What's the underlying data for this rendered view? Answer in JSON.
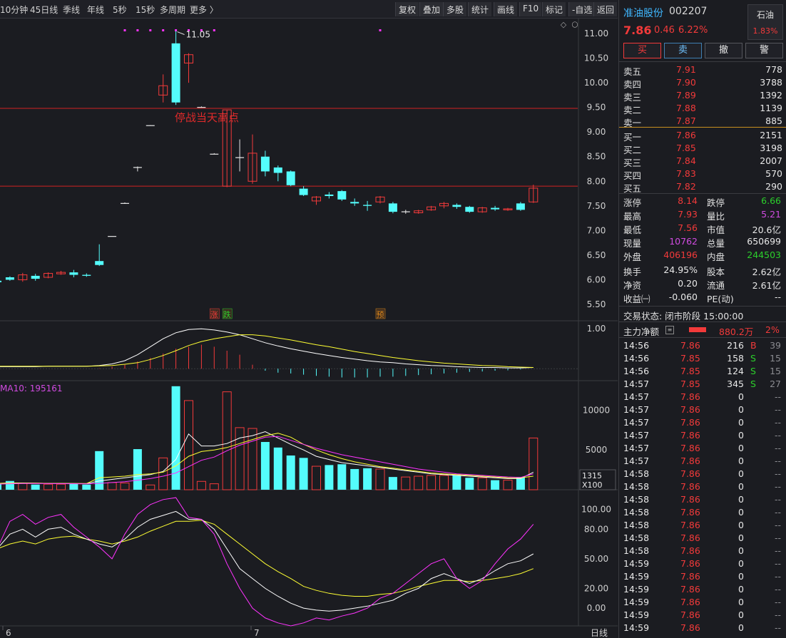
{
  "toolbar": {
    "periods": [
      "10分钟",
      "45日线",
      "季线",
      "年线",
      "5秒",
      "15秒",
      "多周期",
      "更多 〉"
    ],
    "tools": [
      "复权",
      "叠加",
      "多股",
      "统计",
      "画线",
      "F10",
      "标记",
      "-自选",
      "返回"
    ]
  },
  "stock": {
    "name": "准油股份",
    "code": "002207",
    "sector": "石油",
    "sector_pct": "1.83%",
    "price": "7.86",
    "change": "0.46",
    "change_pct": "6.22%"
  },
  "trade_buttons": [
    "买",
    "卖",
    "撤",
    "警"
  ],
  "order_book": {
    "asks": [
      {
        "label": "卖五",
        "price": "7.91",
        "vol": "778"
      },
      {
        "label": "卖四",
        "price": "7.90",
        "vol": "3788"
      },
      {
        "label": "卖三",
        "price": "7.89",
        "vol": "1392"
      },
      {
        "label": "卖二",
        "price": "7.88",
        "vol": "1139"
      },
      {
        "label": "卖一",
        "price": "7.87",
        "vol": "885"
      }
    ],
    "bids": [
      {
        "label": "买一",
        "price": "7.86",
        "vol": "2151"
      },
      {
        "label": "买二",
        "price": "7.85",
        "vol": "3198"
      },
      {
        "label": "买三",
        "price": "7.84",
        "vol": "2007"
      },
      {
        "label": "买四",
        "price": "7.83",
        "vol": "570"
      },
      {
        "label": "买五",
        "price": "7.82",
        "vol": "290"
      }
    ]
  },
  "stats": [
    {
      "l1": "涨停",
      "v1": "8.14",
      "c1": "#f23a3a",
      "l2": "跌停",
      "v2": "6.66",
      "c2": "#2bd02b"
    },
    {
      "l1": "最高",
      "v1": "7.93",
      "c1": "#f23a3a",
      "l2": "量比",
      "v2": "5.21",
      "c2": "#d04be0"
    },
    {
      "l1": "最低",
      "v1": "7.56",
      "c1": "#f23a3a",
      "l2": "市值",
      "v2": "20.6亿",
      "c2": "#e8e8e8"
    },
    {
      "l1": "现量",
      "v1": "10762",
      "c1": "#d04be0",
      "l2": "总量",
      "v2": "650699",
      "c2": "#e8e8e8"
    },
    {
      "l1": "外盘",
      "v1": "406196",
      "c1": "#f23a3a",
      "l2": "内盘",
      "v2": "244503",
      "c2": "#2bd02b"
    },
    {
      "l1": "换手",
      "v1": "24.95%",
      "c1": "#e8e8e8",
      "l2": "股本",
      "v2": "2.62亿",
      "c2": "#e8e8e8"
    },
    {
      "l1": "净资",
      "v1": "0.20",
      "c1": "#e8e8e8",
      "l2": "流通",
      "v2": "2.61亿",
      "c2": "#e8e8e8"
    },
    {
      "l1": "收益㈠",
      "v1": "-0.060",
      "c1": "#e8e8e8",
      "l2": "PE(动)",
      "v2": "--",
      "c2": "#e8e8e8"
    }
  ],
  "trade_state": "交易状态: 闭市阶段 15:00:00",
  "fund_flow": {
    "label": "主力净额",
    "value": "880.2万",
    "pct": "2%"
  },
  "ticks": [
    {
      "t": "14:56",
      "p": "7.86",
      "v": "216",
      "d": "B",
      "n": "39"
    },
    {
      "t": "14:56",
      "p": "7.85",
      "v": "158",
      "d": "S",
      "n": "15"
    },
    {
      "t": "14:56",
      "p": "7.85",
      "v": "124",
      "d": "S",
      "n": "15"
    },
    {
      "t": "14:57",
      "p": "7.85",
      "v": "345",
      "d": "S",
      "n": "27"
    },
    {
      "t": "14:57",
      "p": "7.86",
      "v": "0",
      "d": "",
      "n": "--"
    },
    {
      "t": "14:57",
      "p": "7.86",
      "v": "0",
      "d": "",
      "n": "--"
    },
    {
      "t": "14:57",
      "p": "7.86",
      "v": "0",
      "d": "",
      "n": "--"
    },
    {
      "t": "14:57",
      "p": "7.86",
      "v": "0",
      "d": "",
      "n": "--"
    },
    {
      "t": "14:57",
      "p": "7.86",
      "v": "0",
      "d": "",
      "n": "--"
    },
    {
      "t": "14:57",
      "p": "7.86",
      "v": "0",
      "d": "",
      "n": "--"
    },
    {
      "t": "14:58",
      "p": "7.86",
      "v": "0",
      "d": "",
      "n": "--"
    },
    {
      "t": "14:58",
      "p": "7.86",
      "v": "0",
      "d": "",
      "n": "--"
    },
    {
      "t": "14:58",
      "p": "7.86",
      "v": "0",
      "d": "",
      "n": "--"
    },
    {
      "t": "14:58",
      "p": "7.86",
      "v": "0",
      "d": "",
      "n": "--"
    },
    {
      "t": "14:58",
      "p": "7.86",
      "v": "0",
      "d": "",
      "n": "--"
    },
    {
      "t": "14:58",
      "p": "7.86",
      "v": "0",
      "d": "",
      "n": "--"
    },
    {
      "t": "14:58",
      "p": "7.86",
      "v": "0",
      "d": "",
      "n": "--"
    },
    {
      "t": "14:59",
      "p": "7.86",
      "v": "0",
      "d": "",
      "n": "--"
    },
    {
      "t": "14:59",
      "p": "7.86",
      "v": "0",
      "d": "",
      "n": "--"
    },
    {
      "t": "14:59",
      "p": "7.86",
      "v": "0",
      "d": "",
      "n": "--"
    },
    {
      "t": "14:59",
      "p": "7.86",
      "v": "0",
      "d": "",
      "n": "--"
    },
    {
      "t": "14:59",
      "p": "7.86",
      "v": "0",
      "d": "",
      "n": "--"
    },
    {
      "t": "14:59",
      "p": "7.86",
      "v": "0",
      "d": "",
      "n": "--"
    }
  ],
  "colors": {
    "up": "#f23a3a",
    "down": "#54fcfc",
    "neutral": "#e8e8e8",
    "ma_white": "#ffffff",
    "ma_yellow": "#ffff33",
    "ma_magenta": "#ff33ff",
    "hline": "#d22222"
  },
  "chart_data": {
    "type": "candlestick",
    "price_ticks": [
      11.0,
      10.5,
      10.0,
      9.5,
      9.0,
      8.5,
      8.0,
      7.5,
      7.0,
      6.5,
      6.0,
      5.5
    ],
    "price_range": [
      5.5,
      11.0
    ],
    "high_label": "11.05",
    "hlines": [
      {
        "value": 9.48,
        "label": "停战当天高点"
      },
      {
        "value": 7.9,
        "label": ""
      }
    ],
    "date_labels": [
      {
        "index": 0,
        "text": "6"
      },
      {
        "index": 20,
        "text": "7"
      }
    ],
    "candles": [
      {
        "o": 5.98,
        "h": 6.02,
        "c": 5.95,
        "l": 5.93
      },
      {
        "o": 6.05,
        "h": 6.07,
        "c": 6.0,
        "l": 5.98
      },
      {
        "o": 6.0,
        "h": 6.14,
        "c": 6.1,
        "l": 5.96
      },
      {
        "o": 6.08,
        "h": 6.12,
        "c": 6.02,
        "l": 5.98
      },
      {
        "o": 6.05,
        "h": 6.15,
        "c": 6.13,
        "l": 6.03
      },
      {
        "o": 6.12,
        "h": 6.18,
        "c": 6.15,
        "l": 6.1
      },
      {
        "o": 6.15,
        "h": 6.2,
        "c": 6.1,
        "l": 6.05
      },
      {
        "o": 6.1,
        "h": 6.13,
        "c": 6.08,
        "l": 6.06
      },
      {
        "o": 6.38,
        "h": 6.72,
        "c": 6.3,
        "l": 6.28
      },
      {
        "o": 6.88,
        "h": 6.88,
        "c": 6.88,
        "l": 6.88
      },
      {
        "o": 7.55,
        "h": 7.57,
        "c": 7.55,
        "l": 7.55
      },
      {
        "o": 8.28,
        "h": 8.3,
        "c": 8.27,
        "l": 8.2
      },
      {
        "o": 9.13,
        "h": 9.14,
        "c": 9.13,
        "l": 9.13
      },
      {
        "o": 9.75,
        "h": 10.17,
        "c": 9.94,
        "l": 9.6
      },
      {
        "o": 10.8,
        "h": 11.05,
        "c": 9.6,
        "l": 9.55
      },
      {
        "o": 10.4,
        "h": 10.6,
        "c": 10.57,
        "l": 10.0
      },
      {
        "o": 9.5,
        "h": 9.52,
        "c": 9.5,
        "l": 9.5
      },
      {
        "o": 8.55,
        "h": 8.57,
        "c": 8.55,
        "l": 8.55
      },
      {
        "o": 7.9,
        "h": 9.45,
        "c": 9.45,
        "l": 7.88
      },
      {
        "o": 8.48,
        "h": 8.85,
        "c": 8.48,
        "l": 8.2
      },
      {
        "o": 8.0,
        "h": 8.95,
        "c": 8.57,
        "l": 7.95
      },
      {
        "o": 8.5,
        "h": 8.62,
        "c": 8.2,
        "l": 8.1
      },
      {
        "o": 8.28,
        "h": 8.32,
        "c": 8.17,
        "l": 8.0
      },
      {
        "o": 8.2,
        "h": 8.22,
        "c": 7.92,
        "l": 7.9
      },
      {
        "o": 7.85,
        "h": 7.9,
        "c": 7.72,
        "l": 7.7
      },
      {
        "o": 7.6,
        "h": 7.7,
        "c": 7.68,
        "l": 7.52
      },
      {
        "o": 7.73,
        "h": 7.78,
        "c": 7.7,
        "l": 7.65
      },
      {
        "o": 7.8,
        "h": 7.82,
        "c": 7.63,
        "l": 7.6
      },
      {
        "o": 7.58,
        "h": 7.65,
        "c": 7.55,
        "l": 7.5
      },
      {
        "o": 7.52,
        "h": 7.6,
        "c": 7.5,
        "l": 7.4
      },
      {
        "o": 7.58,
        "h": 7.7,
        "c": 7.68,
        "l": 7.55
      },
      {
        "o": 7.55,
        "h": 7.58,
        "c": 7.38,
        "l": 7.35
      },
      {
        "o": 7.37,
        "h": 7.42,
        "c": 7.38,
        "l": 7.34
      },
      {
        "o": 7.36,
        "h": 7.42,
        "c": 7.4,
        "l": 7.34
      },
      {
        "o": 7.42,
        "h": 7.5,
        "c": 7.48,
        "l": 7.4
      },
      {
        "o": 7.5,
        "h": 7.58,
        "c": 7.55,
        "l": 7.45
      },
      {
        "o": 7.52,
        "h": 7.55,
        "c": 7.48,
        "l": 7.44
      },
      {
        "o": 7.48,
        "h": 7.5,
        "c": 7.38,
        "l": 7.36
      },
      {
        "o": 7.38,
        "h": 7.48,
        "c": 7.46,
        "l": 7.36
      },
      {
        "o": 7.46,
        "h": 7.5,
        "c": 7.43,
        "l": 7.4
      },
      {
        "o": 7.42,
        "h": 7.46,
        "c": 7.44,
        "l": 7.4
      },
      {
        "o": 7.55,
        "h": 7.58,
        "c": 7.42,
        "l": 7.4
      },
      {
        "o": 7.58,
        "h": 7.93,
        "c": 7.86,
        "l": 7.56
      }
    ],
    "markers": [
      {
        "index": 17,
        "text": "涨",
        "color": "#f23a3a"
      },
      {
        "index": 18,
        "text": "跌",
        "color": "#2bd02b"
      },
      {
        "index": 30,
        "text": "预",
        "color": "#e08a1a"
      }
    ],
    "dot_indices": [
      10,
      11,
      12,
      13,
      14,
      15,
      16,
      17,
      30
    ],
    "macd": {
      "ticks": [
        1.0
      ],
      "range": [
        -0.3,
        1.2
      ],
      "hist": [
        0,
        0,
        0,
        0,
        0,
        0,
        0,
        0,
        0.01,
        0.05,
        0.1,
        0.18,
        0.27,
        0.38,
        0.5,
        0.55,
        0.6,
        0.55,
        0.45,
        0.35,
        0.1,
        -0.05,
        -0.1,
        -0.12,
        -0.15,
        -0.18,
        -0.2,
        -0.22,
        -0.22,
        -0.22,
        -0.2,
        -0.2,
        -0.18,
        -0.16,
        -0.14,
        -0.12,
        -0.1,
        -0.08,
        -0.07,
        -0.05,
        -0.04,
        -0.02,
        0
      ],
      "dif": [
        0.05,
        0.05,
        0.05,
        0.05,
        0.06,
        0.06,
        0.06,
        0.06,
        0.08,
        0.12,
        0.2,
        0.35,
        0.55,
        0.75,
        0.9,
        0.98,
        1.0,
        0.97,
        0.92,
        0.85,
        0.75,
        0.65,
        0.57,
        0.5,
        0.44,
        0.38,
        0.33,
        0.28,
        0.24,
        0.2,
        0.17,
        0.15,
        0.12,
        0.1,
        0.08,
        0.07,
        0.05,
        0.04,
        0.03,
        0.03,
        0.02,
        0.02,
        0.03
      ],
      "dea": [
        0.06,
        0.06,
        0.06,
        0.06,
        0.06,
        0.06,
        0.06,
        0.06,
        0.07,
        0.08,
        0.11,
        0.15,
        0.23,
        0.33,
        0.45,
        0.58,
        0.68,
        0.75,
        0.8,
        0.85,
        0.85,
        0.82,
        0.77,
        0.72,
        0.66,
        0.6,
        0.55,
        0.49,
        0.43,
        0.38,
        0.33,
        0.28,
        0.24,
        0.2,
        0.17,
        0.14,
        0.12,
        0.1,
        0.08,
        0.07,
        0.05,
        0.04,
        0.03
      ]
    },
    "volume": {
      "label": "MA10: 195161",
      "ticks": [
        10000,
        5000
      ],
      "range": [
        0,
        13700
      ],
      "right_readout": "1315",
      "unit": "X100",
      "values": [
        850,
        1100,
        800,
        650,
        700,
        700,
        750,
        650,
        4850,
        900,
        850,
        5100,
        600,
        4000,
        13000,
        11200,
        1050,
        750,
        12300,
        7800,
        7700,
        6000,
        5300,
        4300,
        4000,
        2950,
        3100,
        3200,
        2600,
        2700,
        2600,
        1600,
        1600,
        1700,
        1800,
        1800,
        1800,
        1500,
        1500,
        1200,
        1200,
        1600,
        6500
      ],
      "ma_white": [
        800,
        850,
        850,
        820,
        800,
        800,
        780,
        760,
        1100,
        1300,
        1500,
        1700,
        1900,
        2300,
        3800,
        7000,
        5500,
        5500,
        5800,
        6500,
        6800,
        7300,
        6500,
        5700,
        5000,
        4200,
        3800,
        3400,
        3200,
        3000,
        2800,
        2600,
        2400,
        2200,
        2000,
        1900,
        1800,
        1700,
        1600,
        1500,
        1400,
        1400,
        2200
      ],
      "ma_yellow": [
        800,
        820,
        830,
        820,
        800,
        800,
        790,
        780,
        1500,
        1600,
        1700,
        1900,
        2000,
        2200,
        3000,
        4200,
        4800,
        5000,
        5300,
        5800,
        6300,
        6800,
        7100,
        6600,
        5700,
        5000,
        4400,
        3900,
        3500,
        3200,
        2900,
        2700,
        2500,
        2300,
        2100,
        2000,
        1900,
        1800,
        1700,
        1600,
        1500,
        1500,
        1700
      ],
      "ma_magenta": [
        700,
        750,
        780,
        780,
        770,
        760,
        750,
        740,
        800,
        900,
        1000,
        1200,
        1400,
        1700,
        2100,
        2900,
        3700,
        4100,
        4900,
        5600,
        6100,
        6600,
        6700,
        6200,
        5700,
        5200,
        4800,
        4400,
        4100,
        3800,
        3500,
        3200,
        2900,
        2600,
        2400,
        2200,
        2000,
        1900,
        1800,
        1700,
        1600,
        1550,
        2000
      ]
    },
    "kdj": {
      "ticks": [
        100.0,
        80.0,
        50.0,
        20.0,
        0.0
      ],
      "range": [
        -18,
        120
      ],
      "k": [
        60,
        75,
        80,
        72,
        80,
        82,
        75,
        70,
        65,
        62,
        70,
        82,
        90,
        94,
        98,
        90,
        90,
        80,
        60,
        40,
        30,
        20,
        12,
        5,
        0,
        -2,
        -3,
        -2,
        0,
        2,
        5,
        8,
        15,
        20,
        30,
        35,
        30,
        25,
        30,
        38,
        45,
        48,
        55
      ],
      "d": [
        60,
        65,
        68,
        65,
        70,
        72,
        73,
        70,
        68,
        65,
        68,
        72,
        78,
        83,
        88,
        88,
        89,
        85,
        75,
        65,
        55,
        45,
        37,
        30,
        22,
        18,
        15,
        13,
        12,
        12,
        14,
        15,
        18,
        22,
        25,
        28,
        28,
        27,
        28,
        30,
        32,
        35,
        40
      ],
      "j": [
        60,
        88,
        95,
        85,
        92,
        95,
        82,
        72,
        62,
        50,
        75,
        95,
        105,
        110,
        112,
        92,
        90,
        75,
        45,
        20,
        0,
        -10,
        -15,
        -18,
        -15,
        -10,
        -12,
        -8,
        -5,
        0,
        10,
        15,
        25,
        35,
        45,
        50,
        30,
        20,
        28,
        45,
        60,
        70,
        85
      ]
    },
    "bottom_right_label": "日线"
  }
}
